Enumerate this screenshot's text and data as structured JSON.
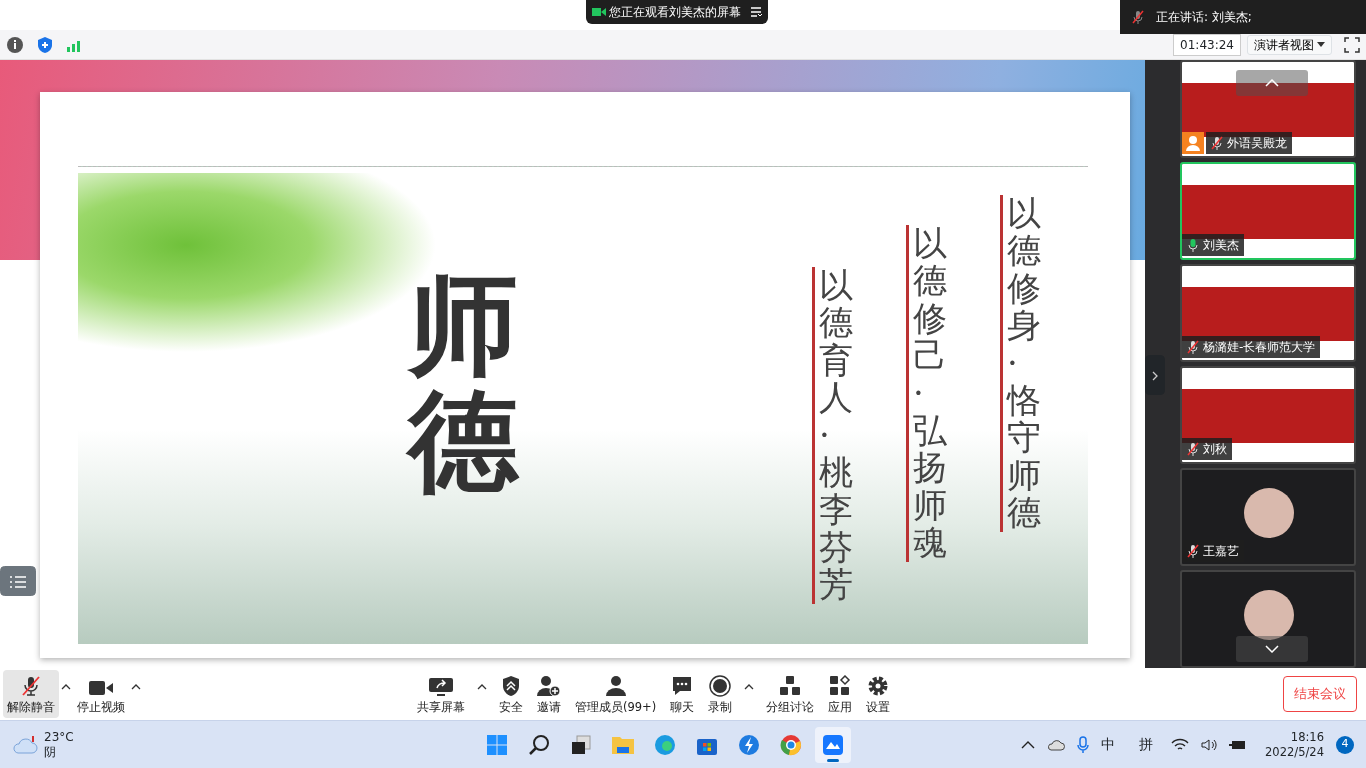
{
  "share_banner": {
    "text": "您正在观看刘美杰的屏幕"
  },
  "speaking": {
    "text": "正在讲话: 刘美杰;"
  },
  "info_bar": {
    "timer": "01:43:24",
    "view_menu": "演讲者视图"
  },
  "slide": {
    "title": "师德",
    "lines": [
      "以德修身·恪守师德",
      "以德修己·弘扬师魂",
      "以德育人·桃李芬芳"
    ]
  },
  "participants": [
    {
      "name": "外语吴殿龙",
      "muted": true,
      "speaking": false,
      "video": true,
      "host": true
    },
    {
      "name": "刘美杰",
      "muted": false,
      "speaking": true,
      "video": true,
      "host": false
    },
    {
      "name": "杨潞娃-长春师范大学",
      "muted": true,
      "speaking": false,
      "video": true,
      "host": false
    },
    {
      "name": "刘秋",
      "muted": true,
      "speaking": false,
      "video": true,
      "host": false
    },
    {
      "name": "王嘉艺",
      "muted": true,
      "speaking": false,
      "video": false,
      "host": false
    }
  ],
  "toolbar": {
    "left": [
      {
        "kind": "mic",
        "label": "解除静音",
        "caret": true
      },
      {
        "kind": "video",
        "label": "停止视频",
        "caret": true
      }
    ],
    "center": [
      {
        "kind": "share",
        "label": "共享屏幕",
        "caret": true
      },
      {
        "kind": "security",
        "label": "安全",
        "caret": false
      },
      {
        "kind": "invite",
        "label": "邀请",
        "caret": false
      },
      {
        "kind": "members",
        "label": "管理成员(99+)",
        "caret": false
      },
      {
        "kind": "chat",
        "label": "聊天",
        "caret": false
      },
      {
        "kind": "record",
        "label": "录制",
        "caret": true
      },
      {
        "kind": "breakout",
        "label": "分组讨论",
        "caret": false
      },
      {
        "kind": "apps",
        "label": "应用",
        "caret": false
      },
      {
        "kind": "settings",
        "label": "设置",
        "caret": false
      }
    ],
    "end_button": "结束会议"
  },
  "taskbar": {
    "weather": {
      "temp": "23°C",
      "condition": "阴"
    },
    "apps": [
      {
        "kind": "start",
        "selected": false
      },
      {
        "kind": "search",
        "selected": false
      },
      {
        "kind": "taskview",
        "selected": false
      },
      {
        "kind": "files",
        "selected": false
      },
      {
        "kind": "edge",
        "selected": false
      },
      {
        "kind": "store",
        "selected": false
      },
      {
        "kind": "bolt",
        "selected": false
      },
      {
        "kind": "chrome",
        "selected": false
      },
      {
        "kind": "meeting",
        "selected": true
      }
    ],
    "ime_mode": "中",
    "ime_name": "拼",
    "time": "18:16",
    "date": "2022/5/24",
    "notifications": "4"
  }
}
